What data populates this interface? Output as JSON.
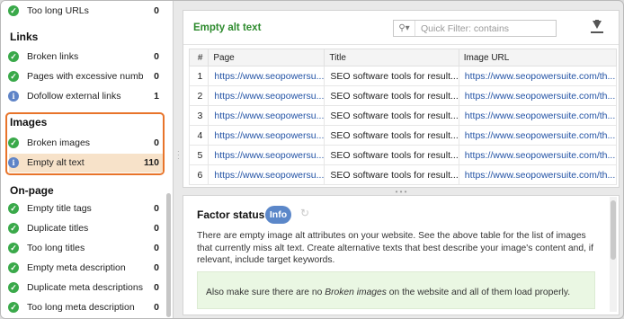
{
  "sidebar": {
    "top_item": {
      "label": "Too long URLs",
      "count": "0"
    },
    "links_heading": "Links",
    "links": [
      {
        "label": "Broken links",
        "count": "0",
        "status": "ok"
      },
      {
        "label": "Pages with excessive number o...",
        "count": "0",
        "status": "ok"
      },
      {
        "label": "Dofollow external links",
        "count": "1",
        "status": "info"
      }
    ],
    "images_heading": "Images",
    "images": [
      {
        "label": "Broken images",
        "count": "0",
        "status": "ok"
      },
      {
        "label": "Empty alt text",
        "count": "110",
        "status": "info"
      }
    ],
    "onpage_heading": "On-page",
    "onpage": [
      {
        "label": "Empty title tags",
        "count": "0",
        "status": "ok"
      },
      {
        "label": "Duplicate titles",
        "count": "0",
        "status": "ok"
      },
      {
        "label": "Too long titles",
        "count": "0",
        "status": "ok"
      },
      {
        "label": "Empty meta description",
        "count": "0",
        "status": "ok"
      },
      {
        "label": "Duplicate meta descriptions",
        "count": "0",
        "status": "ok"
      },
      {
        "label": "Too long meta description",
        "count": "0",
        "status": "ok"
      }
    ]
  },
  "table_panel": {
    "title": "Empty alt text",
    "filter_placeholder": "Quick Filter: contains",
    "columns": [
      "#",
      "Page",
      "Title",
      "Image URL"
    ],
    "rows": [
      {
        "n": "1",
        "page": "https://www.seopowersu...",
        "title": "SEO software tools for result...",
        "image": "https://www.seopowersuite.com/th..."
      },
      {
        "n": "2",
        "page": "https://www.seopowersu...",
        "title": "SEO software tools for result...",
        "image": "https://www.seopowersuite.com/th..."
      },
      {
        "n": "3",
        "page": "https://www.seopowersu...",
        "title": "SEO software tools for result...",
        "image": "https://www.seopowersuite.com/th..."
      },
      {
        "n": "4",
        "page": "https://www.seopowersu...",
        "title": "SEO software tools for result...",
        "image": "https://www.seopowersuite.com/th..."
      },
      {
        "n": "5",
        "page": "https://www.seopowersu...",
        "title": "SEO software tools for result...",
        "image": "https://www.seopowersuite.com/th..."
      },
      {
        "n": "6",
        "page": "https://www.seopowersu...",
        "title": "SEO software tools for result...",
        "image": "https://www.seopowersuite.com/th..."
      }
    ]
  },
  "factor": {
    "label": "Factor status:",
    "status": "Info",
    "description": "There are empty image alt attributes on your website. See the above table for the list of images that currently miss alt text. Create alternative texts that best describe your image's content and, if relevant, include target keywords.",
    "note_prefix": "Also make sure there are no ",
    "note_em": "Broken images",
    "note_suffix": " on the website and all of them load properly."
  },
  "colors": {
    "accent": "#e8742a",
    "ok": "#3aa94a",
    "info": "#5f84c7",
    "title_green": "#2e8b2e",
    "link": "#2353a5"
  }
}
